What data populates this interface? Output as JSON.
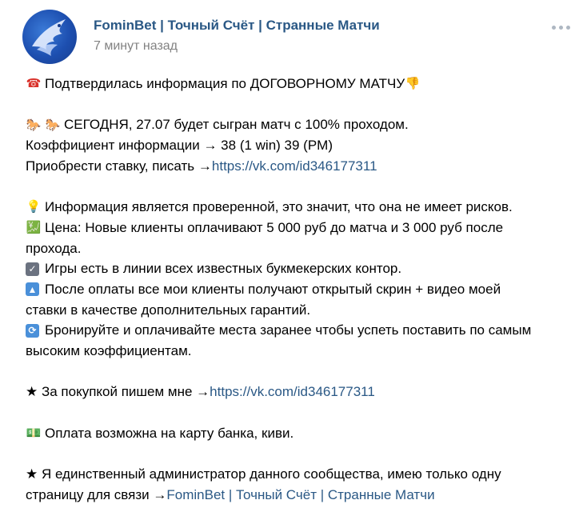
{
  "post": {
    "author": "FominBet | Точный Счёт | Странные Матчи",
    "time": "7 минут назад"
  },
  "body": {
    "l1": "Подтвердилась информация по ДОГОВОРНОМУ МАТЧУ",
    "l2": "СЕГОДНЯ, 27.07 будет сыгран матч с 100% проходом.",
    "l3": "Коэффициент информации → 38 (1 win) 39 (PM)",
    "l4_text": "Приобрести ставку, писать → ",
    "l4_link": "https://vk.com/id346177311",
    "l5": "Информация является проверенной, это значит, что она не имеет рисков.",
    "l6": "Цена: Новые клиенты оплачивают 5 000 руб до матча и 3 000 руб после",
    "l7": "прохода.",
    "l8": "Игры есть в линии всех известных букмекерских контор.",
    "l9": "После оплаты все мои клиенты получают открытый скрин + видео моей",
    "l10": "ставки в качестве дополнительных гарантий.",
    "l11": "Бронируйте и оплачивайте места заранее чтобы успеть поставить по самым",
    "l12": "высоким коэффициентам.",
    "l13_text": "★ За покупкой пишем мне → ",
    "l13_link": "https://vk.com/id346177311",
    "l14": "Оплата возможна на карту банка, киви.",
    "l15": "★ Я единственный администратор данного сообщества, имею только одну",
    "l16_text": "страницу для связи → ",
    "l16_link": "FominBet | Точный Счёт | Странные Матчи"
  },
  "icons": {
    "phone": "phone-icon",
    "thumb": "thumbs-down-icon",
    "horse": "horse-icon",
    "bulb": "light-bulb-icon",
    "money": "money-icon",
    "check": "checkmark-icon",
    "up": "up-arrow-icon",
    "repeat": "repeat-icon",
    "more": "more-icon"
  },
  "colors": {
    "link": "#2a5885",
    "muted": "#828282"
  }
}
